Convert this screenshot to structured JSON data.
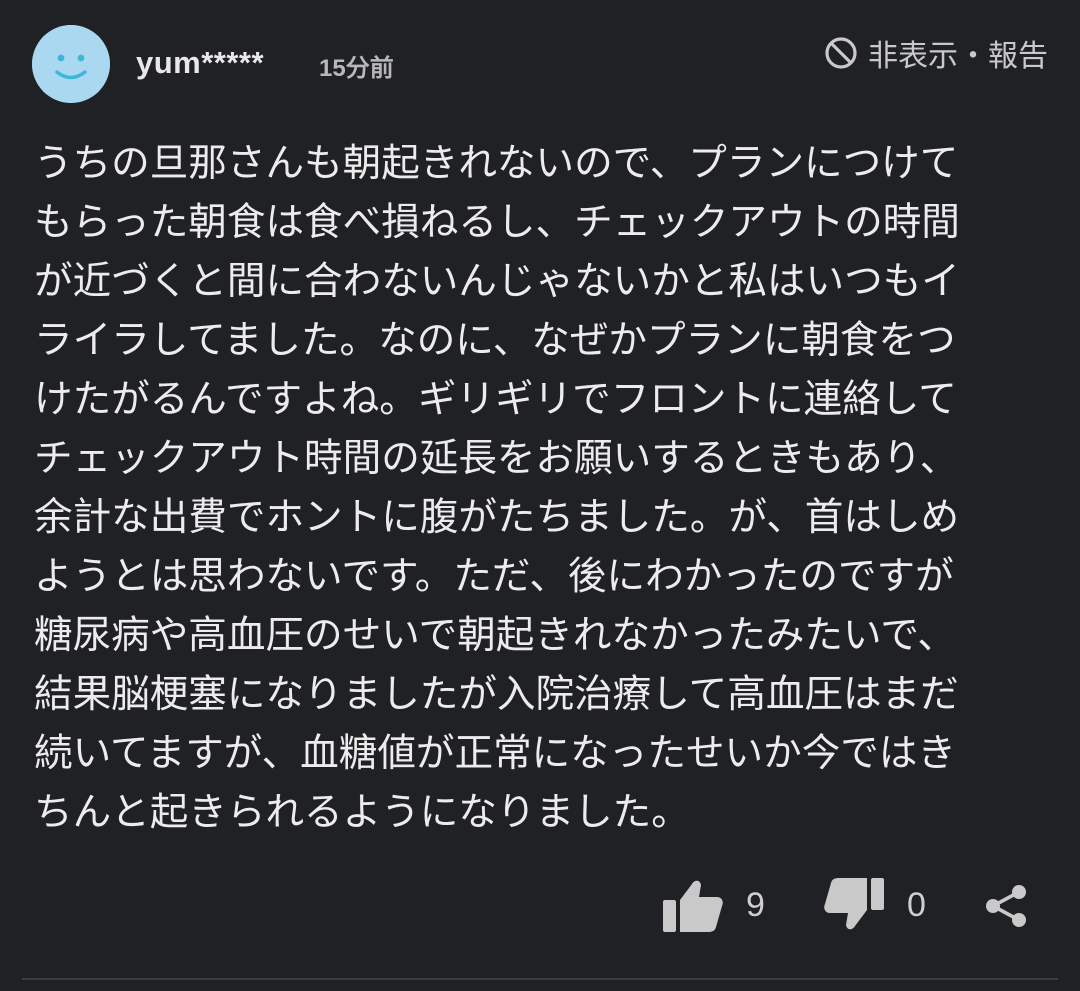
{
  "comment": {
    "username": "yum*****",
    "timestamp": "15分前",
    "hide_report_label": "非表示・報告",
    "text": "うちの旦那さんも朝起きれないので、プランにつけて\nもらった朝食は食べ損ねるし、チェックアウトの時間\nが近づくと間に合わないんじゃないかと私はいつもイ\nライラしてました。なのに、なぜかプランに朝食をつ\nけたがるんですよね。ギリギリでフロントに連絡して\nチェックアウト時間の延長をお願いするときもあり、\n余計な出費でホントに腹がたちました。が、首はしめ\nようとは思わないです。ただ、後にわかったのですが\n糖尿病や高血圧のせいで朝起きれなかったみたいで、\n結果脳梗塞になりましたが入院治療して高血圧はまだ\n続いてますが、血糖値が正常になったせいか今ではき\nちんと起きられるようになりました。",
    "like_count": "9",
    "dislike_count": "0"
  },
  "icons": {
    "avatar": "smiley-face-icon",
    "hide": "prohibited-icon",
    "like": "thumbs-up-icon",
    "dislike": "thumbs-down-icon",
    "share": "share-icon"
  },
  "colors": {
    "background": "#202124",
    "avatar": "#a9d8f0",
    "avatar_face": "#3fb6d8",
    "text": "#ececec",
    "muted": "#b8b8b8",
    "icon": "#c9c9c9"
  }
}
